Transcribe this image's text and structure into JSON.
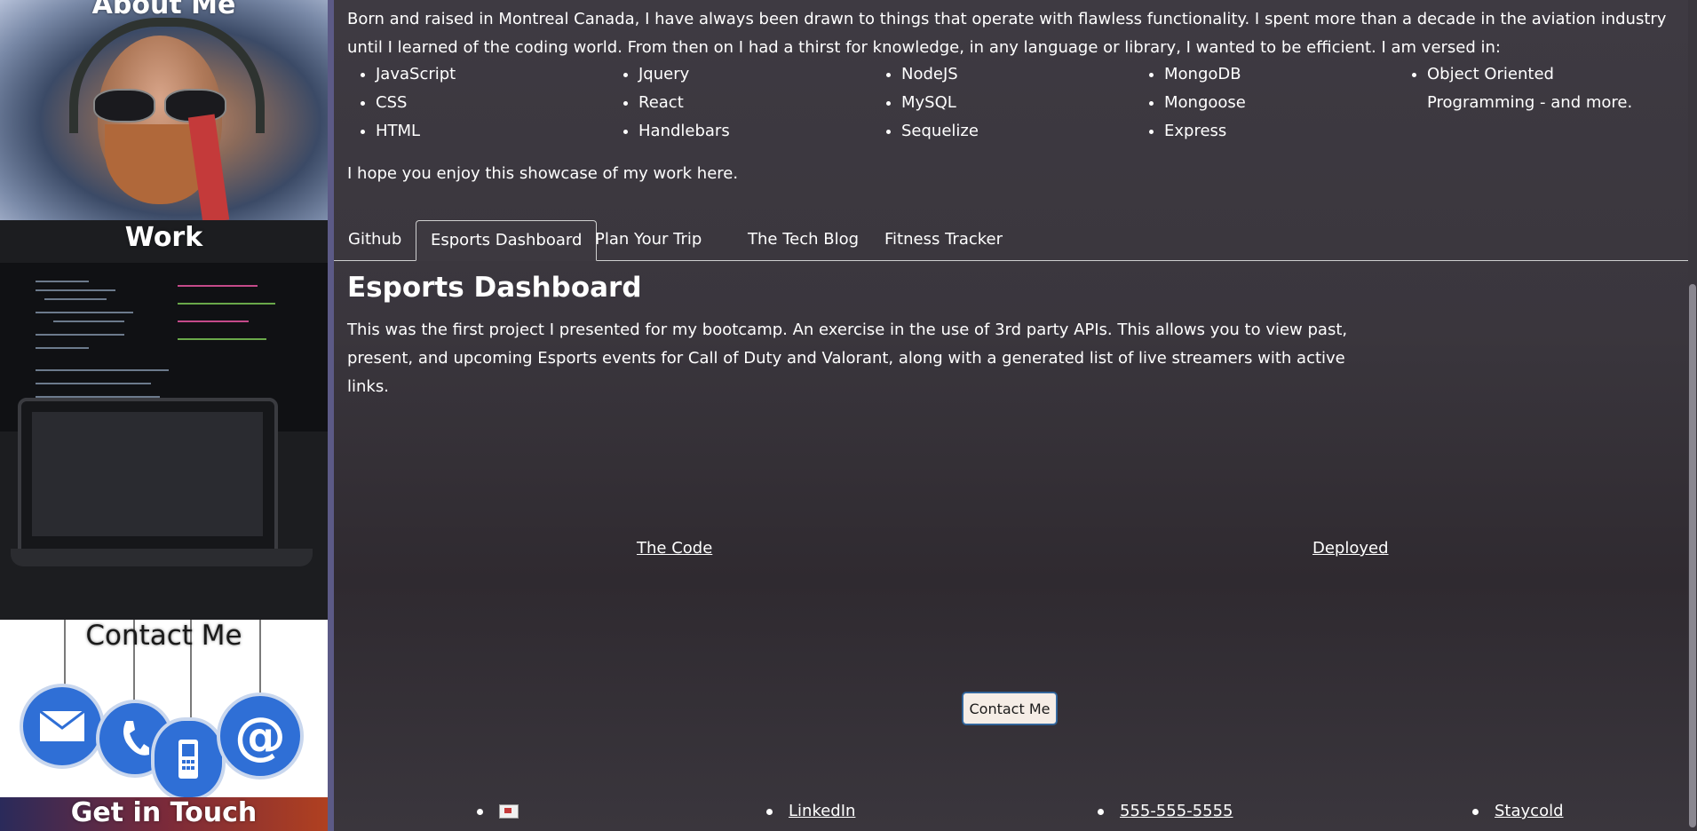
{
  "sidebar": {
    "about_title": "About Me",
    "work_title": "Work",
    "contact_title": "Contact Me",
    "touch_title": "Get in Touch",
    "contact_icons": [
      "envelope-icon",
      "phone-icon",
      "mobile-icon",
      "at-sign-icon"
    ],
    "at_glyph": "@"
  },
  "intro": {
    "text": "Born and raised in Montreal Canada, I have always been drawn to things that operate with flawless functionality. I spent more than a decade in the aviation industry until I learned of the coding world. From then on I had a thirst for knowledge, in any language or library, I wanted to be efficient. I am versed in:",
    "skills": [
      [
        "JavaScript",
        "CSS",
        "HTML"
      ],
      [
        "Jquery",
        "React",
        "Handlebars"
      ],
      [
        "NodeJS",
        "MySQL",
        "Sequelize"
      ],
      [
        "MongoDB",
        "Mongoose",
        "Express"
      ],
      [
        "Object Oriented Programming - and more."
      ]
    ],
    "closing": "I hope you enjoy this showcase of my work here."
  },
  "tabs": [
    "Github",
    "Esports Dashboard",
    "Plan Your Trip",
    "The Tech Blog",
    "Fitness Tracker"
  ],
  "active_tab": "Esports Dashboard",
  "project": {
    "title": "Esports Dashboard",
    "description": "This was the first project I presented for my bootcamp. An exercise in the use of 3rd party APIs. This allows you to view past, present, and upcoming Esports events for Call of Duty and Valorant, along with a generated list of live streamers with active links.",
    "code_link": "The Code",
    "deployed_link": "Deployed"
  },
  "contact_button": "Contact Me",
  "footer": {
    "links": [
      "LinkedIn",
      "555-555-5555",
      "Staycold"
    ]
  },
  "colors": {
    "background": "#3a363d",
    "sidebar_stripe": "#5c5a86",
    "button_bg": "#f5ede6",
    "contact_tag": "#2f6fd6"
  }
}
